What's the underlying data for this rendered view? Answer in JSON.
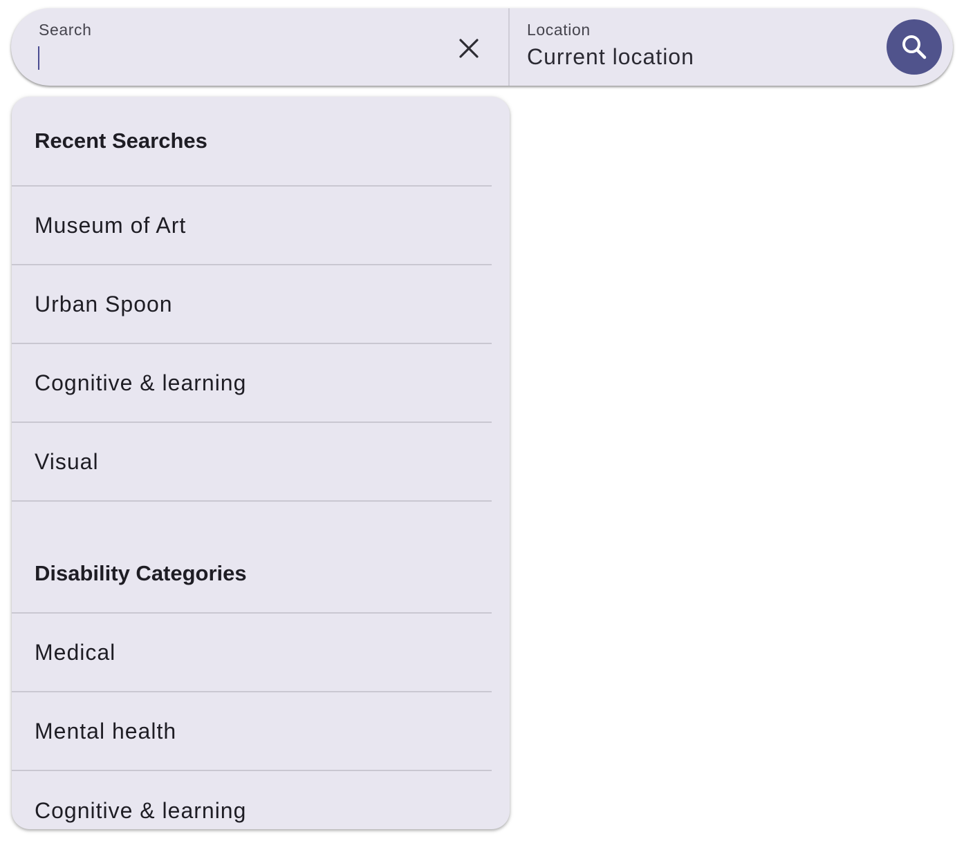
{
  "search": {
    "label": "Search",
    "value": "",
    "clear_icon": "close-icon"
  },
  "location": {
    "label": "Location",
    "value": "Current location"
  },
  "search_button": {
    "icon": "search-icon",
    "color": "#50538c"
  },
  "dropdown": {
    "recent_header": "Recent Searches",
    "recent_items": [
      "Museum of Art",
      "Urban Spoon",
      "Cognitive & learning",
      "Visual"
    ],
    "categories_header": "Disability Categories",
    "category_items": [
      "Medical",
      "Mental health",
      "Cognitive & learning"
    ]
  },
  "colors": {
    "surface": "#e8e6f0",
    "accent": "#50538c",
    "divider": "#c9c7d1"
  }
}
